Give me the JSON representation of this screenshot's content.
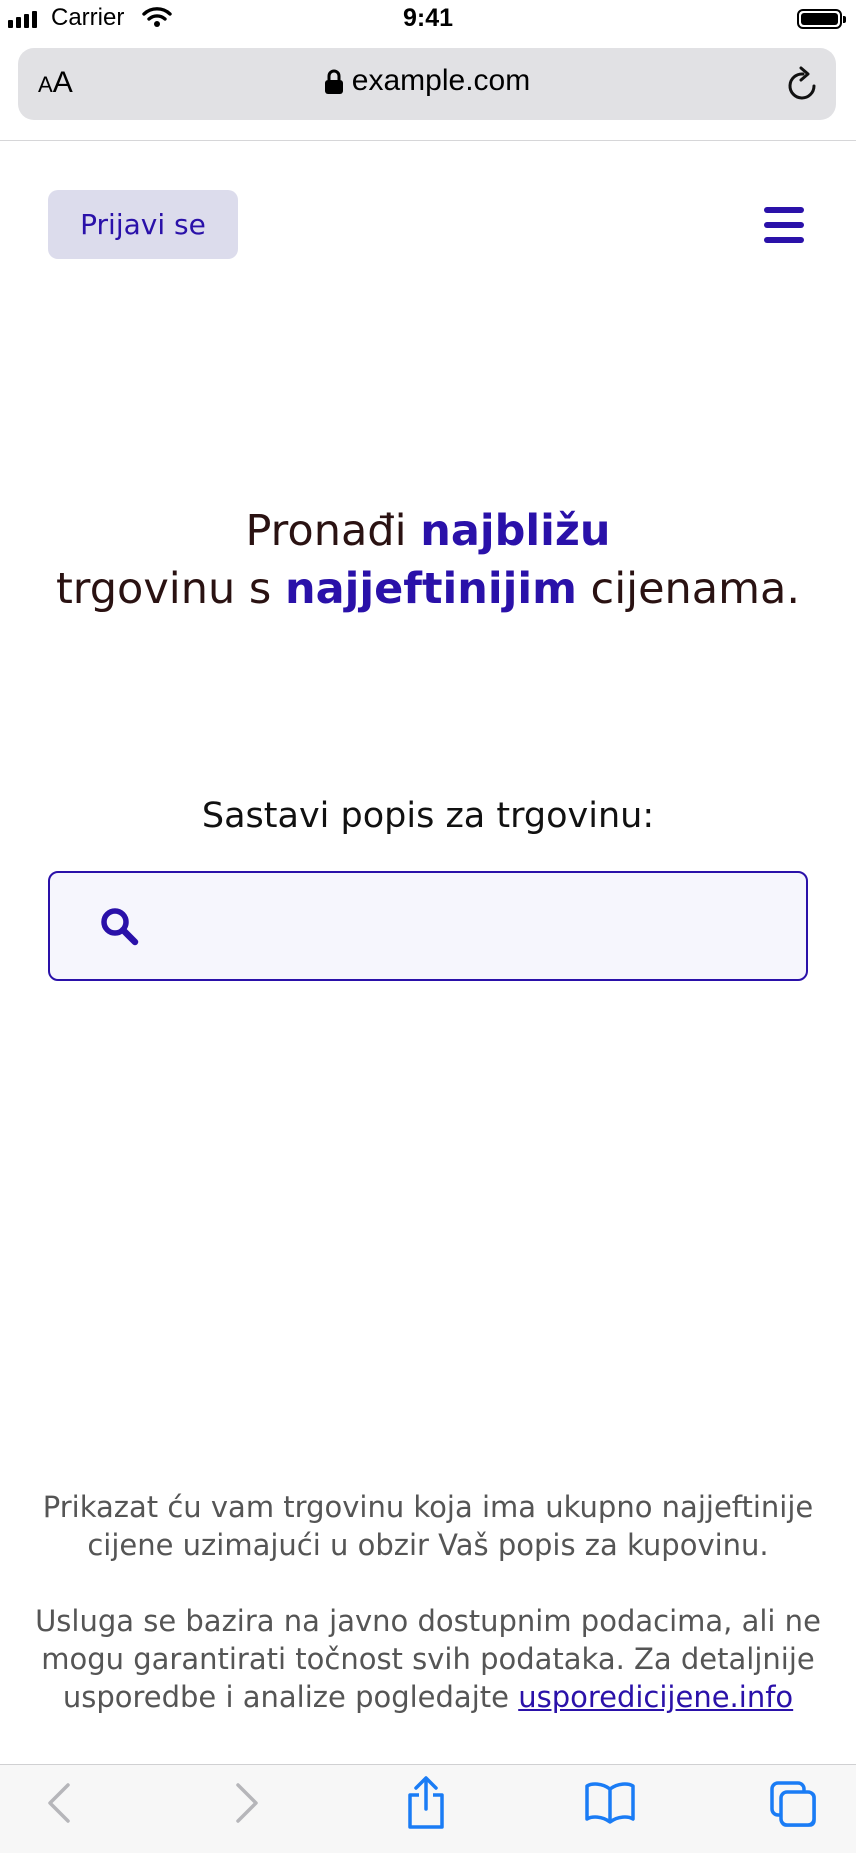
{
  "status_bar": {
    "carrier": "Carrier",
    "time": "9:41"
  },
  "browser": {
    "text_size_small": "A",
    "text_size_big": "A",
    "url": "example.com"
  },
  "header": {
    "login_label": "Prijavi se"
  },
  "hero": {
    "line1_prefix": "Pronađi ",
    "line1_highlight": "najbližu",
    "line2_prefix": "trgovinu s ",
    "line2_highlight": "najjeftinijim",
    "line2_suffix": " cijenama."
  },
  "search": {
    "label": "Sastavi popis za trgovinu:",
    "value": "",
    "placeholder": ""
  },
  "footer": {
    "paragraph1": "Prikazat ću vam trgovinu koja ima ukupno najjeftinije cijene uzimajući u obzir Vaš popis za kupovinu.",
    "paragraph2": "Usluga se bazira na javno dostupnim podacima, ali ne mogu garantirati točnost svih podataka. Za detaljnije usporedbe i analize pogledajte ",
    "link_text": "usporedicijene.info"
  },
  "colors": {
    "accent": "#2a11a9",
    "ios_blue": "#1a7cf5"
  },
  "icons": [
    "signal-icon",
    "wifi-icon",
    "battery-icon",
    "lock-icon",
    "reload-icon",
    "menu-icon",
    "search-icon",
    "back-icon",
    "forward-icon",
    "share-icon",
    "bookmarks-icon",
    "tabs-icon"
  ]
}
